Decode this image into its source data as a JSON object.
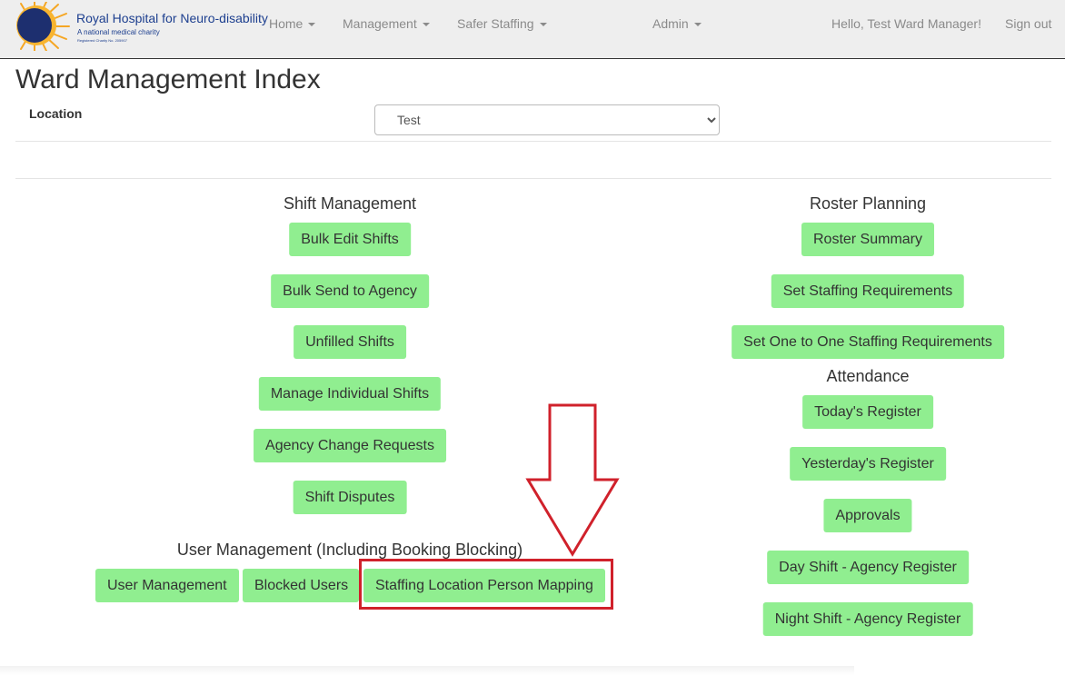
{
  "brand": {
    "name": "Royal Hospital for Neuro-disability",
    "tagline": "A national medical charity",
    "registered": "Registered Charity No. 205907"
  },
  "nav": {
    "home": "Home",
    "management": "Management",
    "safer_staffing": "Safer Staffing",
    "admin": "Admin",
    "greeting": "Hello, Test Ward Manager!",
    "sign_out": "Sign out"
  },
  "page": {
    "title": "Ward Management Index",
    "location_label": "Location",
    "location_value": "Test"
  },
  "shift_management": {
    "title": "Shift Management",
    "buttons": [
      "Bulk Edit Shifts",
      "Bulk Send to Agency",
      "Unfilled Shifts",
      "Manage Individual Shifts",
      "Agency Change Requests",
      "Shift Disputes"
    ]
  },
  "user_management": {
    "title": "User Management (Including Booking Blocking)",
    "buttons": [
      "User Management",
      "Blocked Users",
      "Staffing Location Person Mapping"
    ]
  },
  "roster_planning": {
    "title": "Roster Planning",
    "buttons": [
      "Roster Summary",
      "Set Staffing Requirements",
      "Set One to One Staffing Requirements"
    ]
  },
  "attendance": {
    "title": "Attendance",
    "buttons": [
      "Today's Register",
      "Yesterday's Register",
      "Approvals",
      "Day Shift - Agency Register",
      "Night Shift - Agency Register"
    ]
  },
  "colors": {
    "button_bg": "#90ee90",
    "annotation": "#d0212b",
    "brand_blue": "#1d3f8f",
    "brand_sun": "#f5a623"
  },
  "icons": {
    "logo": "sun-eclipse-logo",
    "caret": "caret-down-icon",
    "annotation_arrow": "down-arrow-icon"
  }
}
